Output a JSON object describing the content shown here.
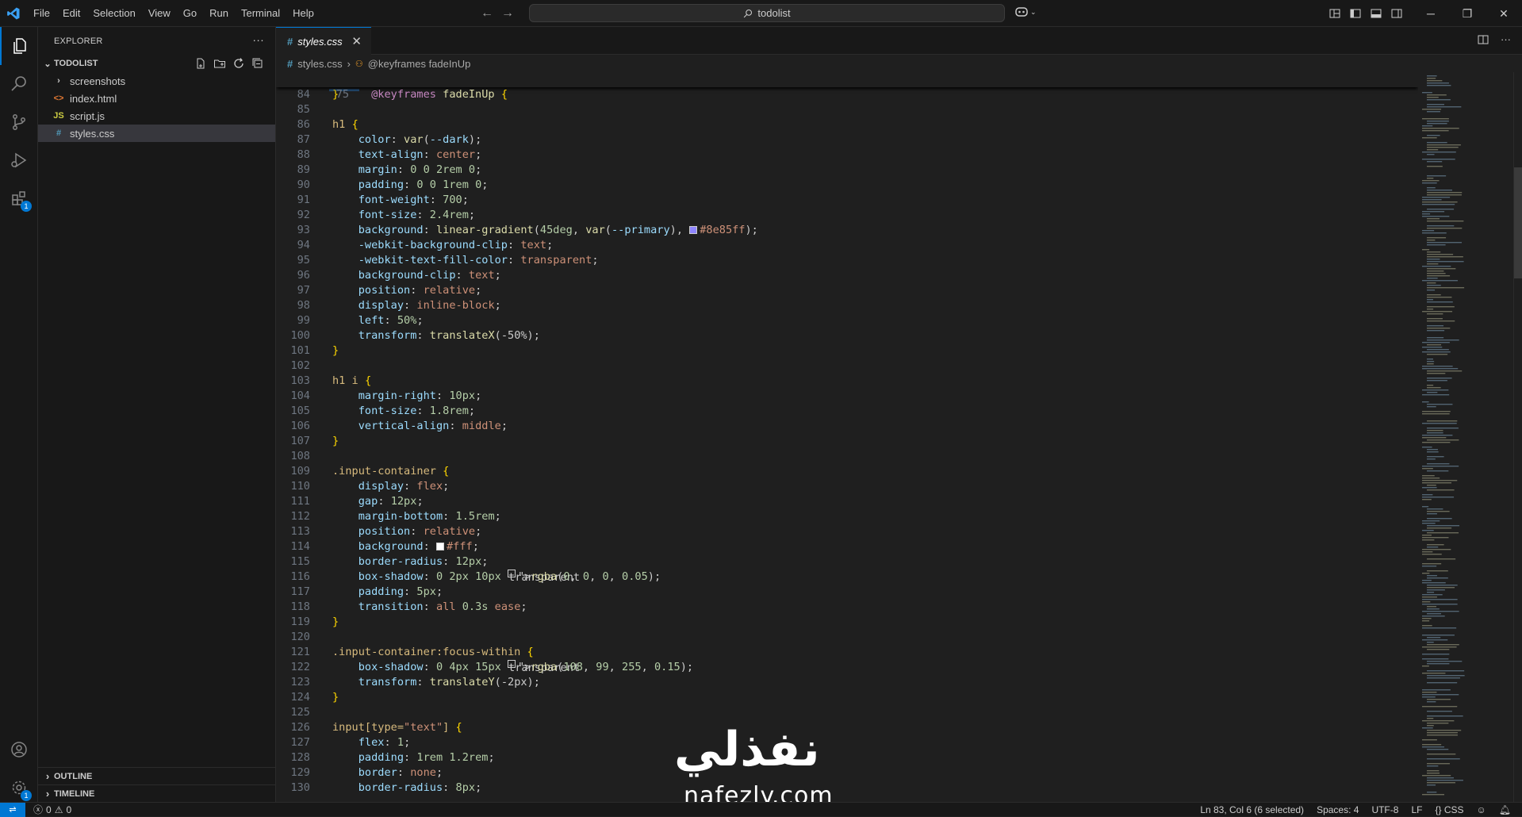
{
  "window": {
    "menu": [
      "File",
      "Edit",
      "Selection",
      "View",
      "Go",
      "Run",
      "Terminal",
      "Help"
    ],
    "search_text": "todolist"
  },
  "activity": {
    "extensions_badge": "1",
    "settings_badge": "1"
  },
  "sidebar": {
    "title": "EXPLORER",
    "folder": "TODOLIST",
    "items": [
      {
        "label": "screenshots",
        "type": "folder"
      },
      {
        "label": "index.html",
        "type": "html"
      },
      {
        "label": "script.js",
        "type": "js",
        "icon_text": "JS"
      },
      {
        "label": "styles.css",
        "type": "css",
        "icon_text": "#"
      }
    ],
    "outline": "OUTLINE",
    "timeline": "TIMELINE"
  },
  "editor": {
    "tab_label": "styles.css",
    "breadcrumb_file": "styles.css",
    "breadcrumb_symbol": "@keyframes fadeInUp",
    "sticky_line_number": "75",
    "sticky_at": "@keyframes",
    "sticky_name": "fadeInUp",
    "lines": [
      {
        "n": "84",
        "t": "}"
      },
      {
        "n": "85",
        "t": ""
      },
      {
        "n": "86",
        "t": "h1 {"
      },
      {
        "n": "87",
        "t": "    color: var(--dark);"
      },
      {
        "n": "88",
        "t": "    text-align: center;"
      },
      {
        "n": "89",
        "t": "    margin: 0 0 2rem 0;"
      },
      {
        "n": "90",
        "t": "    padding: 0 0 1rem 0;"
      },
      {
        "n": "91",
        "t": "    font-weight: 700;"
      },
      {
        "n": "92",
        "t": "    font-size: 2.4rem;"
      },
      {
        "n": "93",
        "t": "    background: linear-gradient(45deg, var(--primary), #8e85ff);"
      },
      {
        "n": "94",
        "t": "    -webkit-background-clip: text;"
      },
      {
        "n": "95",
        "t": "    -webkit-text-fill-color: transparent;"
      },
      {
        "n": "96",
        "t": "    background-clip: text;"
      },
      {
        "n": "97",
        "t": "    position: relative;"
      },
      {
        "n": "98",
        "t": "    display: inline-block;"
      },
      {
        "n": "99",
        "t": "    left: 50%;"
      },
      {
        "n": "100",
        "t": "    transform: translateX(-50%);"
      },
      {
        "n": "101",
        "t": "}"
      },
      {
        "n": "102",
        "t": ""
      },
      {
        "n": "103",
        "t": "h1 i {"
      },
      {
        "n": "104",
        "t": "    margin-right: 10px;"
      },
      {
        "n": "105",
        "t": "    font-size: 1.8rem;"
      },
      {
        "n": "106",
        "t": "    vertical-align: middle;"
      },
      {
        "n": "107",
        "t": "}"
      },
      {
        "n": "108",
        "t": ""
      },
      {
        "n": "109",
        "t": ".input-container {"
      },
      {
        "n": "110",
        "t": "    display: flex;"
      },
      {
        "n": "111",
        "t": "    gap: 12px;"
      },
      {
        "n": "112",
        "t": "    margin-bottom: 1.5rem;"
      },
      {
        "n": "113",
        "t": "    position: relative;"
      },
      {
        "n": "114",
        "t": "    background: #fff;"
      },
      {
        "n": "115",
        "t": "    border-radius: 12px;"
      },
      {
        "n": "116",
        "t": "    box-shadow: 0 2px 10px rgba(0, 0, 0, 0.05);"
      },
      {
        "n": "117",
        "t": "    padding: 5px;"
      },
      {
        "n": "118",
        "t": "    transition: all 0.3s ease;"
      },
      {
        "n": "119",
        "t": "}"
      },
      {
        "n": "120",
        "t": ""
      },
      {
        "n": "121",
        "t": ".input-container:focus-within {"
      },
      {
        "n": "122",
        "t": "    box-shadow: 0 4px 15px rgba(108, 99, 255, 0.15);"
      },
      {
        "n": "123",
        "t": "    transform: translateY(-2px);"
      },
      {
        "n": "124",
        "t": "}"
      },
      {
        "n": "125",
        "t": ""
      },
      {
        "n": "126",
        "t": "input[type=\"text\"] {"
      },
      {
        "n": "127",
        "t": "    flex: 1;"
      },
      {
        "n": "128",
        "t": "    padding: 1rem 1.2rem;"
      },
      {
        "n": "129",
        "t": "    border: none;"
      },
      {
        "n": "130",
        "t": "    border-radius: 8px;"
      }
    ]
  },
  "watermark": {
    "arabic": "نفذلي",
    "latin": "nafezly.com"
  },
  "status": {
    "errors": "0",
    "warnings": "0",
    "cursor": "Ln 83, Col 6 (6 selected)",
    "spaces": "Spaces: 4",
    "encoding": "UTF-8",
    "eol": "LF",
    "language": "CSS"
  },
  "colors": {
    "accent": "#0078d4",
    "swatch_8e85ff": "#8e85ff",
    "swatch_fff": "#ffffff"
  }
}
